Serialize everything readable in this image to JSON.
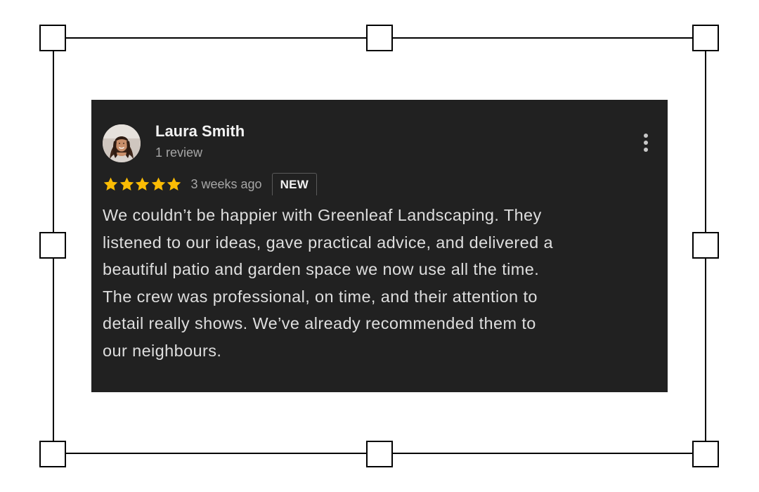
{
  "review": {
    "reviewer_name": "Laura Smith",
    "reviewer_meta": "1 review",
    "rating": 5,
    "date": "3 weeks ago",
    "badge": "NEW",
    "text": "We couldn’t be happier with Greenleaf Landscaping. They\nlistened to our ideas, gave practical advice, and delivered a\nbeautiful patio and garden space we now use all the time.\nThe crew was professional, on time, and their attention to\ndetail really shows. We’ve already recommended them to\nour neighbours."
  },
  "icons": {
    "more": "more-vertical-icon",
    "star": "star-icon",
    "avatar": "avatar-photo"
  },
  "colors": {
    "card_background": "#212121",
    "star": "#fbbc04",
    "primary_text": "#f2f2f2",
    "secondary_text": "#a6a6a6",
    "body_text": "#dedede",
    "selection_frame": "#000000"
  }
}
